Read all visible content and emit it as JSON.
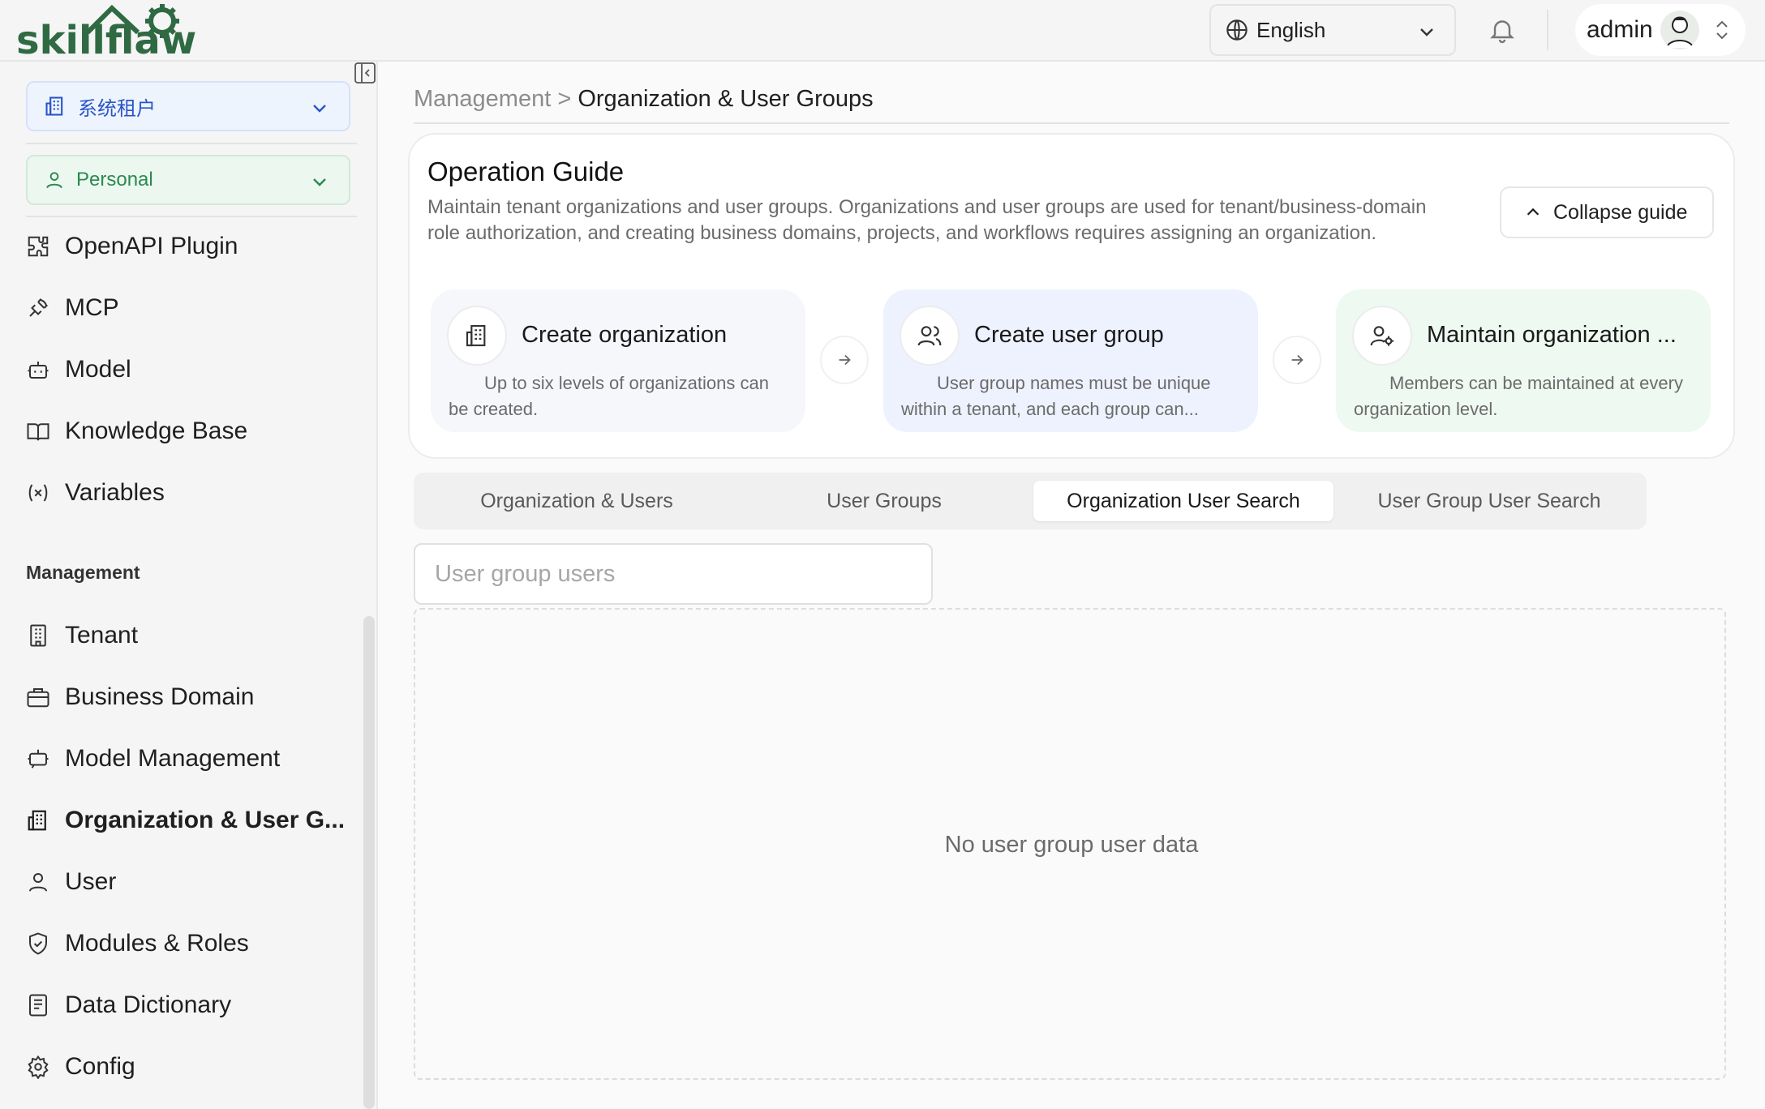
{
  "header": {
    "logo_text": "skillflaw",
    "language": {
      "value": "English",
      "icon": "globe-icon"
    },
    "notification_icon": "bell-icon",
    "user": {
      "name": "admin",
      "icon": "avatar"
    }
  },
  "sidebar": {
    "tenant_select": "系统租户",
    "scope_select": "Personal",
    "items": [
      {
        "label": "OpenAPI Plugin",
        "icon": "puzzle-icon"
      },
      {
        "label": "MCP",
        "icon": "plug-icon"
      },
      {
        "label": "Model",
        "icon": "robot-icon"
      },
      {
        "label": "Knowledge Base",
        "icon": "book-icon"
      },
      {
        "label": "Variables",
        "icon": "variable-icon"
      }
    ],
    "management_heading": "Management",
    "management_items": [
      {
        "label": "Tenant",
        "icon": "building-icon"
      },
      {
        "label": "Business Domain",
        "icon": "briefcase-icon"
      },
      {
        "label": "Model Management",
        "icon": "bot-chat-icon"
      },
      {
        "label": "Organization & User G...",
        "icon": "organization-icon",
        "active": true
      },
      {
        "label": "User",
        "icon": "user-icon"
      },
      {
        "label": "Modules & Roles",
        "icon": "shield-icon"
      },
      {
        "label": "Data Dictionary",
        "icon": "dictionary-icon"
      },
      {
        "label": "Config",
        "icon": "gear-icon"
      }
    ]
  },
  "breadcrumb": {
    "parent": "Management",
    "separator": ">",
    "current": "Organization & User Groups"
  },
  "guide": {
    "title": "Operation Guide",
    "description": "Maintain tenant organizations and user groups. Organizations and user groups are used for tenant/business-domain role authorization, and creating business domains, projects, and workflows requires assigning an organization.",
    "collapse_label": "Collapse guide",
    "steps": [
      {
        "title": "Create organization",
        "desc": "Up to six levels of organizations can be created.",
        "icon": "organization-icon",
        "color": "#f5f7fb"
      },
      {
        "title": "Create user group",
        "desc": "User group names must be unique within a tenant, and each group can...",
        "icon": "users-icon",
        "color": "#eef2fe"
      },
      {
        "title": "Maintain organization ...",
        "desc": "Members can be maintained at every organization level.",
        "icon": "user-settings-icon",
        "color": "#eef9f2"
      }
    ]
  },
  "tabs": [
    {
      "label": "Organization & Users",
      "active": false
    },
    {
      "label": "User Groups",
      "active": false
    },
    {
      "label": "Organization User Search",
      "active": true
    },
    {
      "label": "User Group User Search",
      "active": false
    }
  ],
  "search": {
    "placeholder": "User group users",
    "value": ""
  },
  "empty_state": "No user group user data",
  "colors": {
    "tenant_accent": "#2a55c7",
    "personal_accent": "#2a8a4e",
    "logo_green": "#2f6a43"
  }
}
